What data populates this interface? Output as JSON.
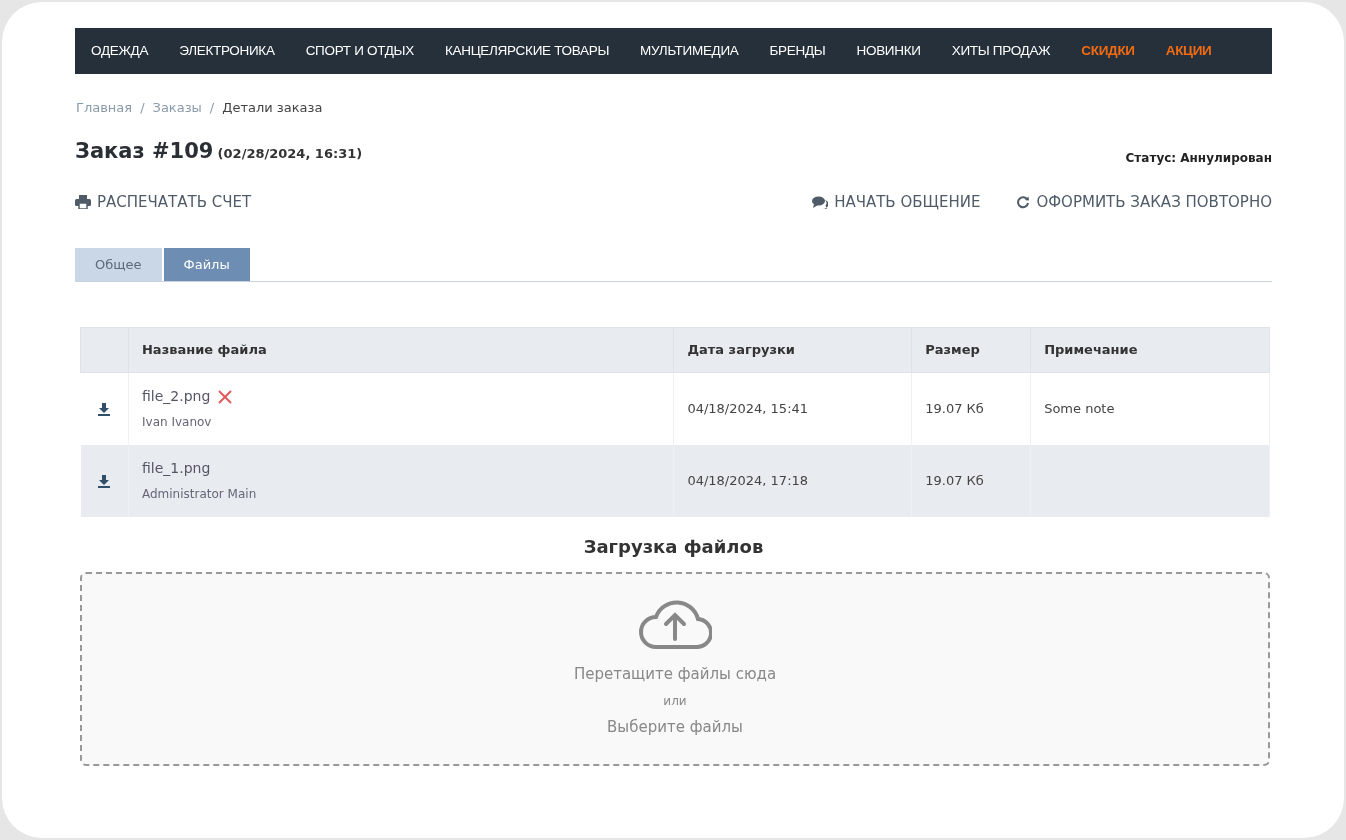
{
  "nav": [
    {
      "label": "ОДЕЖДА",
      "highlighted": false
    },
    {
      "label": "ЭЛЕКТРОНИКА",
      "highlighted": false
    },
    {
      "label": "СПОРТ И ОТДЫХ",
      "highlighted": false
    },
    {
      "label": "КАНЦЕЛЯРСКИЕ ТОВАРЫ",
      "highlighted": false
    },
    {
      "label": "МУЛЬТИМЕДИА",
      "highlighted": false
    },
    {
      "label": "БРЕНДЫ",
      "highlighted": false
    },
    {
      "label": "НОВИНКИ",
      "highlighted": false
    },
    {
      "label": "ХИТЫ ПРОДАЖ",
      "highlighted": false
    },
    {
      "label": "СКИДКИ",
      "highlighted": true
    },
    {
      "label": "АКЦИИ",
      "highlighted": true
    }
  ],
  "breadcrumb": {
    "items": [
      "Главная",
      "Заказы",
      "Детали заказа"
    ],
    "separator": "/"
  },
  "order": {
    "title": "Заказ #109",
    "date": "(02/28/2024, 16:31)",
    "status": "Статус: Аннулирован"
  },
  "actions": {
    "print": "РАСПЕЧАТАТЬ СЧЕТ",
    "chat": "НАЧАТЬ ОБЩЕНИЕ",
    "reorder": "ОФОРМИТЬ ЗАКАЗ ПОВТОРНО"
  },
  "tabs": [
    {
      "label": "Общее",
      "selected": false
    },
    {
      "label": "Файлы",
      "selected": true
    }
  ],
  "table": {
    "columns": [
      "Название файла",
      "Дата загрузки",
      "Размер",
      "Примечание"
    ],
    "rows": [
      {
        "file": "file_2.png",
        "deletable": true,
        "author": "Ivan Ivanov",
        "date": "04/18/2024, 15:41",
        "size": "19.07 Кб",
        "note": "Some note"
      },
      {
        "file": "file_1.png",
        "deletable": false,
        "author": "Administrator Main",
        "date": "04/18/2024, 17:18",
        "size": "19.07 Кб"
      }
    ]
  },
  "upload": {
    "title": "Загрузка файлов",
    "drop_text": "Перетащите файлы сюда",
    "or_text": "или",
    "choose_text": "Выберите файлы"
  }
}
